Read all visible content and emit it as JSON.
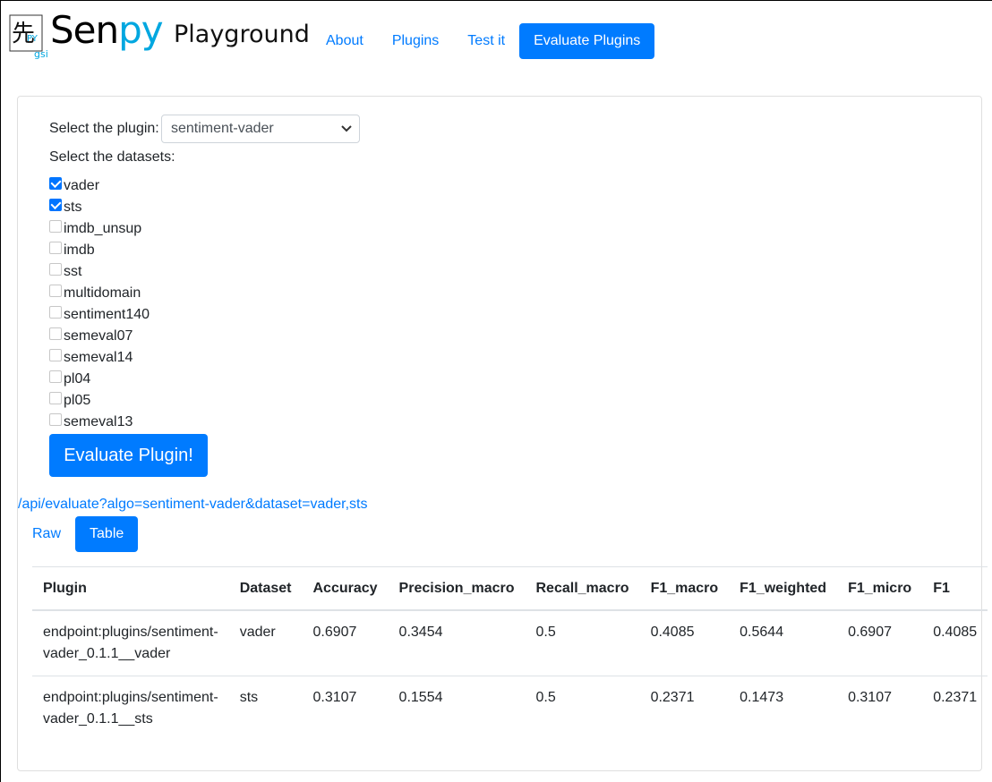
{
  "header": {
    "brand_main": "Sen",
    "brand_py": "py",
    "brand_sub": "Playground",
    "logo_glyph": "先",
    "logo_py": "PY",
    "logo_gsi": "gsi"
  },
  "nav": {
    "items": [
      {
        "label": "About"
      },
      {
        "label": "Plugins"
      },
      {
        "label": "Test it"
      },
      {
        "label": "Evaluate Plugins"
      }
    ]
  },
  "form": {
    "plugin_label": "Select the plugin:",
    "plugin_value": "sentiment-vader",
    "datasets_label": "Select the datasets:",
    "datasets": [
      {
        "name": "vader",
        "checked": true
      },
      {
        "name": "sts",
        "checked": true
      },
      {
        "name": "imdb_unsup",
        "checked": false
      },
      {
        "name": "imdb",
        "checked": false
      },
      {
        "name": "sst",
        "checked": false
      },
      {
        "name": "multidomain",
        "checked": false
      },
      {
        "name": "sentiment140",
        "checked": false
      },
      {
        "name": "semeval07",
        "checked": false
      },
      {
        "name": "semeval14",
        "checked": false
      },
      {
        "name": "pl04",
        "checked": false
      },
      {
        "name": "pl05",
        "checked": false
      },
      {
        "name": "semeval13",
        "checked": false
      }
    ],
    "submit_label": "Evaluate Plugin!"
  },
  "result": {
    "api_link": "/api/evaluate?algo=sentiment-vader&dataset=vader,sts",
    "tabs": [
      {
        "label": "Raw"
      },
      {
        "label": "Table"
      }
    ],
    "columns": [
      "Plugin",
      "Dataset",
      "Accuracy",
      "Precision_macro",
      "Recall_macro",
      "F1_macro",
      "F1_weighted",
      "F1_micro",
      "F1"
    ],
    "rows": [
      [
        "endpoint:plugins/sentiment-vader_0.1.1__vader",
        "vader",
        "0.6907",
        "0.3454",
        "0.5",
        "0.4085",
        "0.5644",
        "0.6907",
        "0.4085"
      ],
      [
        "endpoint:plugins/sentiment-vader_0.1.1__sts",
        "sts",
        "0.3107",
        "0.1554",
        "0.5",
        "0.2371",
        "0.1473",
        "0.3107",
        "0.2371"
      ]
    ]
  },
  "colors": {
    "accent": "#007bff",
    "brand_py": "#00a7e0"
  }
}
